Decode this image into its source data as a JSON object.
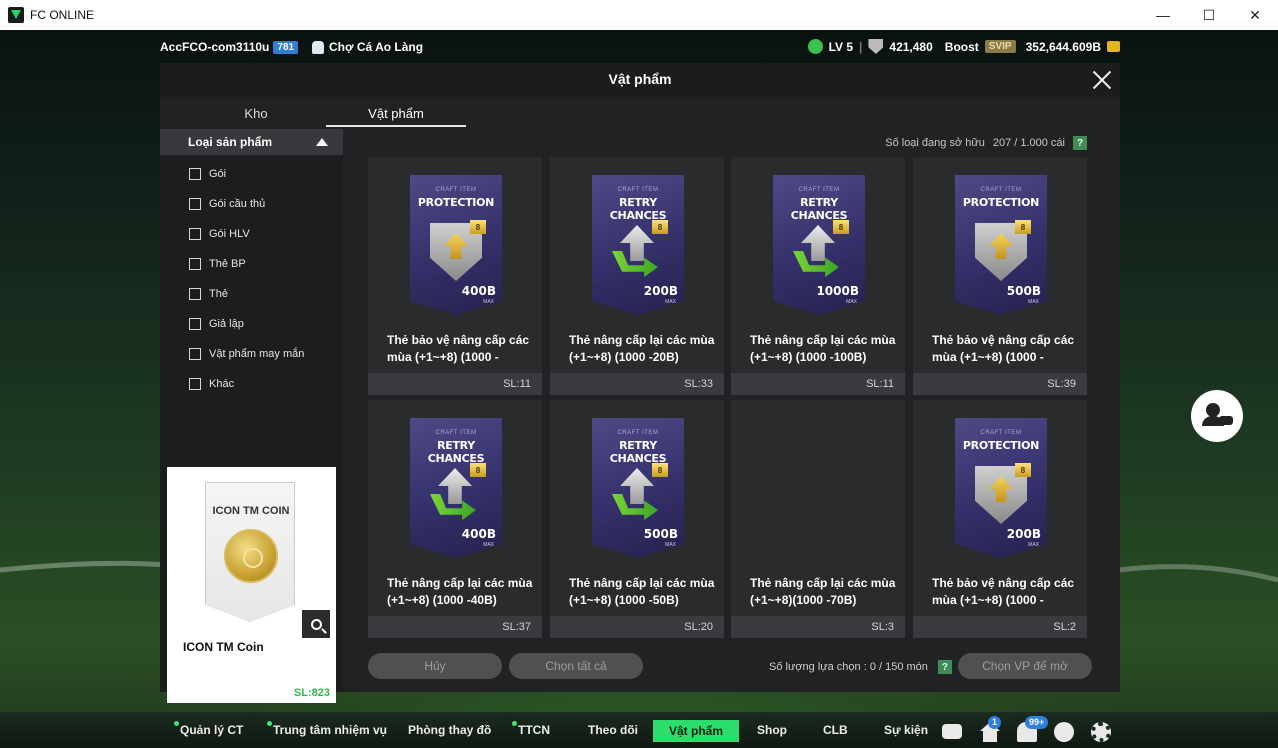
{
  "window": {
    "title": "FC ONLINE",
    "min": "—",
    "max": "☐",
    "close": "✕"
  },
  "topbar": {
    "account": "AccFCO-com3110u",
    "account_badge": "781",
    "market": "Chợ Cá Ao Làng",
    "level": "LV 5",
    "shield_value": "421,480",
    "boost": "Boost",
    "svip": "SVIP",
    "bp": "352,644.609B"
  },
  "modal": {
    "title": "Vật phẩm",
    "tabs": [
      "Kho",
      "Vật phẩm"
    ],
    "category_header": "Loại sản phẩm",
    "filters": [
      "Gói",
      "Gói cầu thủ",
      "Gói HLV",
      "Thẻ BP",
      "Thẻ",
      "Giả lập",
      "Vật phẩm may mắn",
      "Khác"
    ],
    "owned_label": "Số loại đang sở hữu",
    "owned_value": "207 / 1.000 cái",
    "help": "?",
    "preview": {
      "card_title": "ICON TM COIN",
      "name": "ICON TM Coin",
      "sl": "SL:823"
    },
    "items": [
      {
        "kind": "protection",
        "sub": "CRAFT ITEM",
        "head": "PROTECTION",
        "badge": "8",
        "value": "400B",
        "max": "MAX",
        "name": "Thẻ bảo vệ nâng cấp các mùa (+1~+8) (1000 -",
        "sl": "SL:11"
      },
      {
        "kind": "retry",
        "sub": "CRAFT ITEM",
        "head": "RETRY CHANCES",
        "badge": "8",
        "value": "200B",
        "max": "MAX",
        "name": "Thẻ nâng cấp lại các mùa (+1~+8) (1000 -20B)",
        "sl": "SL:33"
      },
      {
        "kind": "retry",
        "sub": "CRAFT ITEM",
        "head": "RETRY CHANCES",
        "badge": "8",
        "value": "1000B",
        "max": "MAX",
        "name": "Thẻ nâng cấp lại các mùa (+1~+8) (1000 -100B)",
        "sl": "SL:11"
      },
      {
        "kind": "protection",
        "sub": "CRAFT ITEM",
        "head": "PROTECTION",
        "badge": "8",
        "value": "500B",
        "max": "MAX",
        "name": "Thẻ bảo vệ nâng cấp các mùa (+1~+8) (1000 -",
        "sl": "SL:39"
      },
      {
        "kind": "retry",
        "sub": "CRAFT ITEM",
        "head": "RETRY CHANCES",
        "badge": "8",
        "value": "400B",
        "max": "MAX",
        "name": "Thẻ nâng cấp lại các mùa (+1~+8) (1000 -40B)",
        "sl": "SL:37"
      },
      {
        "kind": "retry",
        "sub": "CRAFT ITEM",
        "head": "RETRY CHANCES",
        "badge": "8",
        "value": "500B",
        "max": "MAX",
        "name": "Thẻ nâng cấp lại các mùa (+1~+8) (1000 -50B)",
        "sl": "SL:20"
      },
      {
        "kind": "empty",
        "sub": "",
        "head": "",
        "badge": "",
        "value": "",
        "max": "",
        "name": "Thẻ nâng cấp lại các mùa (+1~+8)(1000 -70B)",
        "sl": "SL:3"
      },
      {
        "kind": "protection",
        "sub": "CRAFT ITEM",
        "head": "PROTECTION",
        "badge": "8",
        "value": "200B",
        "max": "MAX",
        "name": "Thẻ bảo vệ nâng cấp các mùa (+1~+8) (1000 -",
        "sl": "SL:2"
      }
    ],
    "buttons": {
      "cancel": "Hủy",
      "select_all": "Chọn tất cả",
      "confirm": "Chọn VP để mở"
    },
    "select_count_label": "Số lượng lựa chọn : 0 / 150 món"
  },
  "nav": {
    "items": [
      "Quản lý CT",
      "Trung tâm nhiệm vụ",
      "Phòng thay đồ",
      "TTCN",
      "Theo dõi",
      "Vật phẩm",
      "Shop",
      "CLB",
      "Sự kiện"
    ],
    "house_badge": "1",
    "bell_badge": "99+"
  },
  "colors": {
    "accent_green": "#2bde6c",
    "count_green": "#2db54a",
    "badge_blue": "#2c7fe0"
  }
}
